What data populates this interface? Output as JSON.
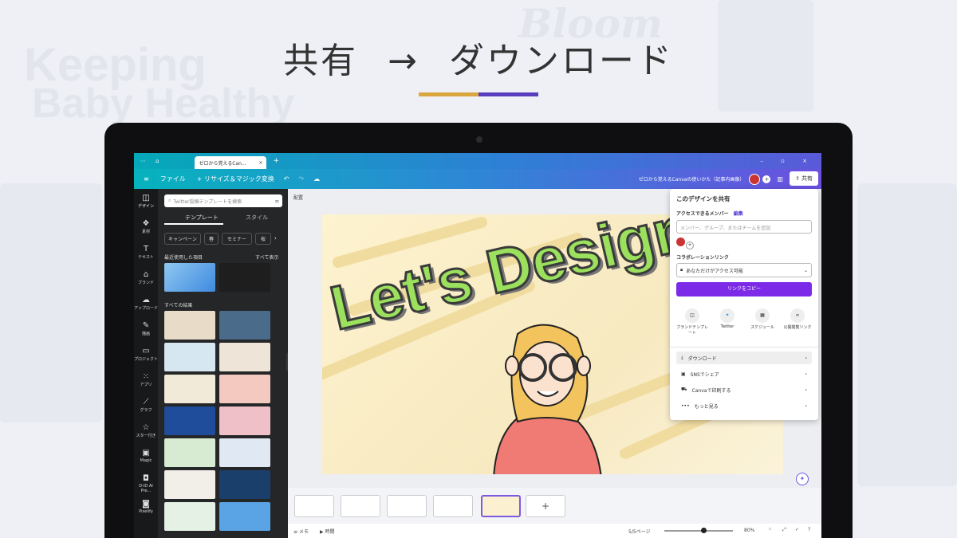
{
  "heading": {
    "left": "共有",
    "arrow": "→",
    "right": "ダウンロード"
  },
  "accent_colors": {
    "gold": "#d9a640",
    "purple": "#5a3dbf"
  },
  "background_text": [
    "Keeping",
    "Baby Healthy",
    "Bloom"
  ],
  "browser": {
    "tab_title": "ゼロから覚えるCan...",
    "new_tab": "+"
  },
  "toolbar": {
    "menu_icon": "≡",
    "file": "ファイル",
    "resize": "+ リサイズ＆マジック変換",
    "doc_title": "ゼロから覚えるCanvaの使いかた（記事内画像）",
    "share": "共有"
  },
  "rail": [
    "デザイン",
    "素材",
    "テキスト",
    "ブランド",
    "アップロード",
    "描画",
    "プロジェクト",
    "アプリ",
    "グラフ",
    "スター付き",
    "Magic",
    "D-ID AI Pre...",
    "Pixelify"
  ],
  "panel": {
    "search_placeholder": "Twitter投稿テンプレートを検索",
    "tab_templates": "テンプレート",
    "tab_styles": "スタイル",
    "chips": [
      "キャンペーン",
      "春",
      "セミナー",
      "桜"
    ],
    "recent_label": "最近使用した項目",
    "see_all": "すべて表示",
    "all_results": "すべての結果"
  },
  "canvas": {
    "label": "配置",
    "text": "Let's Design"
  },
  "share_panel": {
    "title": "このデザインを共有",
    "members_label": "アクセスできるメンバー",
    "edit_link": "編集",
    "input_placeholder": "メンバー、グループ、またはチームを追加",
    "collab_label": "コラボレーションリンク",
    "access_option": "あなただけがアクセス可能",
    "copy_button": "リンクをコピー",
    "quick_actions": [
      "ブランドテンプレート",
      "Twitter",
      "スケジュール",
      "公開閲覧リンク"
    ],
    "menu": [
      "ダウンロード",
      "SNSでシェア",
      "Canvaで印刷する",
      "もっと見る"
    ]
  },
  "status": {
    "notes": "メモ",
    "timer": "時間",
    "page_count": "5/5ページ",
    "zoom": "80%"
  },
  "add_page": "+"
}
